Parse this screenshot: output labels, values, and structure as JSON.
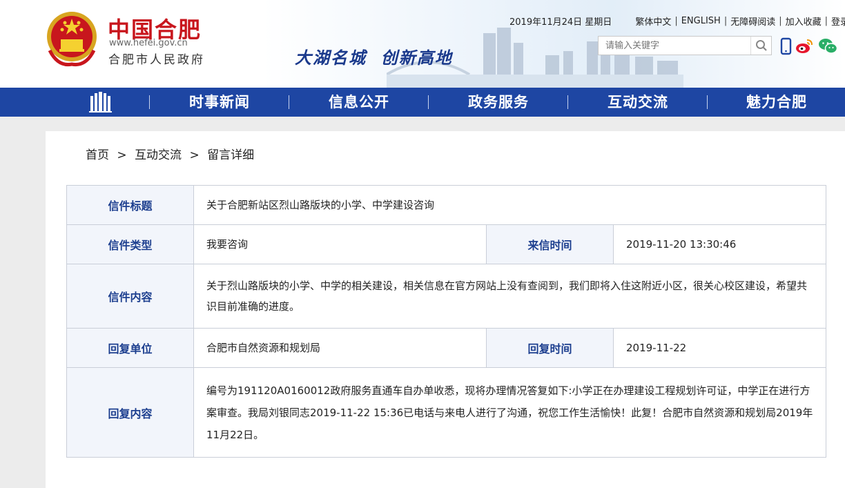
{
  "header": {
    "logo_cn": "中国合肥",
    "logo_url": "www.hefei.gov.cn",
    "logo_sub": "合肥市人民政府",
    "slogan": "大湖名城  创新高地",
    "date": "2019年11月24日 星期日",
    "links": [
      "繁体中文",
      "ENGLISH",
      "无障碍阅读",
      "加入收藏",
      "登录"
    ],
    "search_placeholder": "请输入关键字",
    "icons": [
      "search-icon",
      "mobile-icon",
      "weibo-icon",
      "wechat-icon"
    ]
  },
  "nav": {
    "items": [
      "时事新闻",
      "信息公开",
      "政务服务",
      "互动交流",
      "魅力合肥"
    ]
  },
  "breadcrumb": {
    "home": "首页",
    "section": "互动交流",
    "current": "留言详细",
    "separator": ">"
  },
  "letter": {
    "title_label": "信件标题",
    "title_value": "关于合肥新站区烈山路版块的小学、中学建设咨询",
    "type_label": "信件类型",
    "type_value": "我要咨询",
    "time_label": "来信时间",
    "time_value": "2019-11-20 13:30:46",
    "content_label": "信件内容",
    "content_value": "关于烈山路版块的小学、中学的相关建设，相关信息在官方网站上没有查阅到，我们即将入住这附近小区，很关心校区建设，希望共识目前准确的进度。",
    "reply_unit_label": "回复单位",
    "reply_unit_value": "合肥市自然资源和规划局",
    "reply_time_label": "回复时间",
    "reply_time_value": "2019-11-22",
    "reply_content_label": "回复内容",
    "reply_content_value": "编号为191120A0160012政府服务直通车自办单收悉，现将办理情况答复如下:小学正在办理建设工程规划许可证，中学正在进行方案审查。我局刘银同志2019-11-22 15:36已电话与来电人进行了沟通，祝您工作生活愉快！此复！合肥市自然资源和规划局2019年11月22日。"
  },
  "colors": {
    "nav_bg": "#1e46a3",
    "logo_red": "#c8161d",
    "label_blue": "#1d3f8f",
    "label_bg": "#f2f5fb"
  }
}
